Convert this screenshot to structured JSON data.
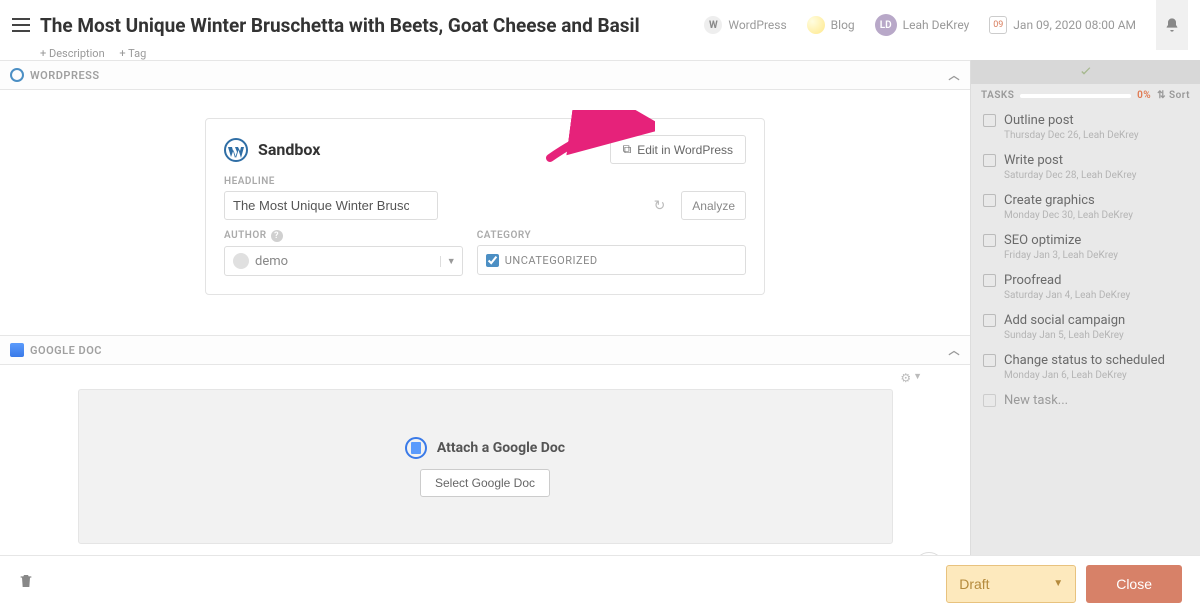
{
  "header": {
    "title": "The Most Unique Winter Bruschetta with Beets, Goat Cheese and Basil",
    "add_description": "+ Description",
    "add_tag": "+ Tag",
    "wordpress_label": "WordPress",
    "blog_label": "Blog",
    "user_name": "Leah DeKrey",
    "user_initials": "LD",
    "date_time": "Jan 09, 2020 08:00 AM",
    "cal_day": "09"
  },
  "wordpress_section": {
    "label": "WORDPRESS"
  },
  "sandbox_card": {
    "title": "Sandbox",
    "edit_button": "Edit in WordPress",
    "headline_label": "HEADLINE",
    "headline_value": "The Most Unique Winter Bruschetta with Beets, Goat Cheese and Basil",
    "analyze_button": "Analyze",
    "author_label": "AUTHOR",
    "author_value": "demo",
    "category_label": "CATEGORY",
    "category_value": "UNCATEGORIZED"
  },
  "google_doc_section": {
    "label": "GOOGLE DOC",
    "attach_title": "Attach a Google Doc",
    "select_button": "Select Google Doc"
  },
  "tasks": {
    "label": "TASKS",
    "percent": "0%",
    "sort_label": "Sort",
    "new_task": "New task...",
    "items": [
      {
        "label": "Outline post",
        "meta": "Thursday Dec 26,  Leah DeKrey"
      },
      {
        "label": "Write post",
        "meta": "Saturday Dec 28,  Leah DeKrey"
      },
      {
        "label": "Create graphics",
        "meta": "Monday Dec 30,  Leah DeKrey"
      },
      {
        "label": "SEO optimize",
        "meta": "Friday Jan 3,  Leah DeKrey"
      },
      {
        "label": "Proofread",
        "meta": "Saturday Jan 4,  Leah DeKrey"
      },
      {
        "label": "Add social campaign",
        "meta": "Sunday Jan 5,  Leah DeKrey"
      },
      {
        "label": "Change status to scheduled",
        "meta": "Monday Jan 6,  Leah DeKrey"
      }
    ]
  },
  "footer": {
    "draft": "Draft",
    "close": "Close"
  }
}
